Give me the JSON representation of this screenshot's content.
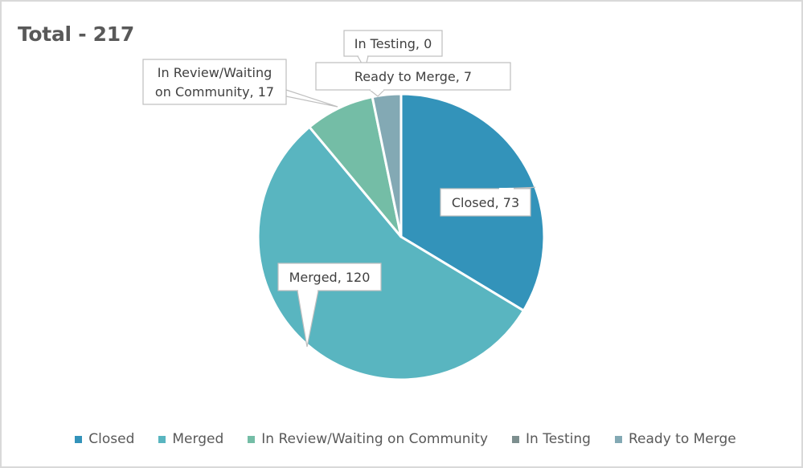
{
  "chart_data": {
    "type": "pie",
    "title": "Total - 217",
    "categories": [
      "Closed",
      "Merged",
      "In Review/Waiting on Community",
      "In Testing",
      "Ready to Merge"
    ],
    "values": [
      73,
      120,
      17,
      0,
      7
    ],
    "colors": [
      "#3393BA",
      "#59B5C0",
      "#74BDA6",
      "#7D8F8F",
      "#83A9B4"
    ],
    "data_labels": [
      "Closed, 73",
      "Merged, 120",
      "In Review/Waiting on Community, 17",
      "In Testing, 0",
      "Ready to Merge, 7"
    ],
    "data_label_lines": [
      [
        "Closed, 73"
      ],
      [
        "Merged, 120"
      ],
      [
        "In Review/Waiting",
        "on Community, 17"
      ],
      [
        "In Testing, 0"
      ],
      [
        "Ready to Merge, 7"
      ]
    ],
    "legend_position": "bottom",
    "start_angle": "12 o'clock",
    "direction": "clockwise"
  }
}
